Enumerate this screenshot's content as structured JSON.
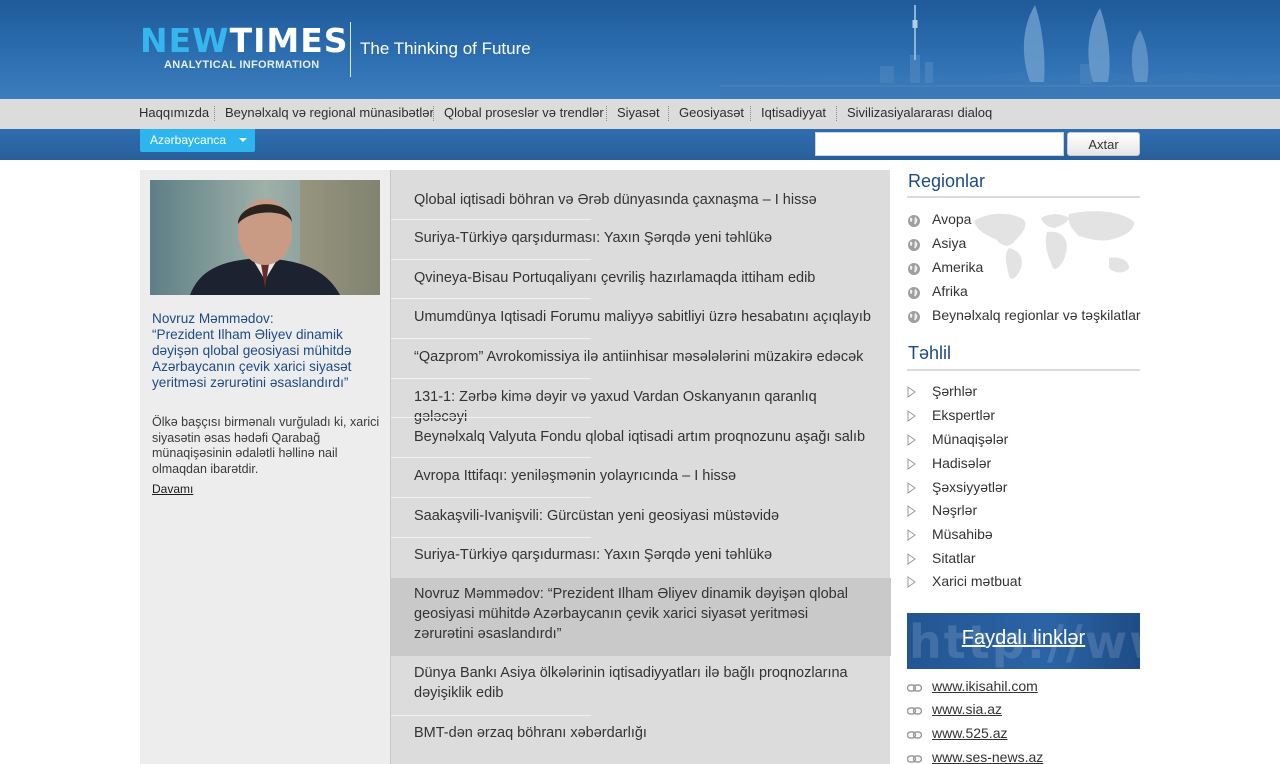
{
  "header": {
    "logo_new": "NEW",
    "logo_times": "TIMES",
    "logo_sub": "ANALYTICAL INFORMATION",
    "tagline": "The Thinking of Future"
  },
  "nav": [
    {
      "label": "Haqqımızda"
    },
    {
      "label": "Beynəlxalq və regional münasibətlər"
    },
    {
      "label": "Qlobal proseslər və trendlər"
    },
    {
      "label": "Siyasət"
    },
    {
      "label": "Geosiyasət"
    },
    {
      "label": "Iqtisadiyyat"
    },
    {
      "label": "Sivilizasiyalararası dialoq"
    }
  ],
  "language": {
    "selected": "Azərbaycanca"
  },
  "search": {
    "value": "",
    "button": "Axtar"
  },
  "featured": {
    "title": "Novruz Məmmədov:\n“Prezident Ilham Əliyev dinamik dəyişən qlobal geosiyasi mühitdə Azərbaycanın çevik xarici siyasət yeritməsi zərurətini əsaslandırdı”",
    "text": "Ölkə başçısı birmənalı vurğuladı ki, xarici siyasətin əsas hədəfi Qarabağ münaqişəsinin ədalətli həllinə nail olmaqdan ibarətdir.",
    "more": "Davamı"
  },
  "news": [
    {
      "title": "Qlobal iqtisadi böhran və Ərəb dünyasında çaxnaşma – I hissə",
      "active": false
    },
    {
      "title": "Suriya-Türkiyə qarşıdurması: Yaxın Şərqdə yeni təhlükə",
      "active": false
    },
    {
      "title": "Qvineya-Bisau Portuqaliyanı çevriliş hazırlamaqda ittiham edib",
      "active": false
    },
    {
      "title": "Umumdünya Iqtisadi Forumu maliyyə sabitliyi üzrə hesabatını açıqlayıb",
      "active": false
    },
    {
      "title": "“Qazprom” Avrokomissiya ilə antiinhisar məsələlərini müzakirə edəcək",
      "active": false
    },
    {
      "title": "131-1: Zərbə kimə dəyir və yaxud Vardan Oskanyanın qaranlıq gələcəyi",
      "active": false
    },
    {
      "title": "Beynəlxalq Valyuta Fondu qlobal iqtisadi artım proqnozunu aşağı salıb",
      "active": false
    },
    {
      "title": "Avropa Ittifaqı: yeniləşmənin yolayrıcında – I hissə",
      "active": false
    },
    {
      "title": "Saakaşvili-Ivanişvili: Gürcüstan yeni geosiyasi müstəvidə",
      "active": false
    },
    {
      "title": "Suriya-Türkiyə qarşıdurması: Yaxın Şərqdə yeni təhlükə",
      "active": false
    },
    {
      "title": "Novruz Məmmədov: “Prezident Ilham Əliyev dinamik dəyişən qlobal geosiyasi mühitdə Azərbaycanın çevik xarici siyasət yeritməsi zərurətini əsaslandırdı”",
      "active": true
    },
    {
      "title": "Dünya Bankı Asiya ölkələrinin iqtisadiyyatları ilə bağlı proqnozlarına dəyişiklik edib",
      "active": false
    },
    {
      "title": "BMT-dən ərzaq böhranı xəbərdarlığı",
      "active": false
    }
  ],
  "regions": {
    "title": "Regionlar",
    "items": [
      "Avopa",
      "Asiya",
      "Amerika",
      "Afrika",
      "Beynəlxalq regionlar və təşkilatlar"
    ]
  },
  "analysis": {
    "title": "Təhlil",
    "items": [
      "Şərhlər",
      "Ekspertlər",
      "Münaqişələr",
      "Hadisələr",
      "Şəxsiyyətlər",
      "Nəşrlər",
      "Müsahibə",
      "Sitatlar",
      "Xarici mətbuat"
    ]
  },
  "useful_links": {
    "title": "Faydalı linklər",
    "watermark": "http://www",
    "items": [
      "www.ikisahil.com",
      "www.sia.az",
      "www.525.az",
      "www.ses-news.az"
    ]
  },
  "colors": {
    "header_blue": "#2c6eb0",
    "logo_cyan": "#35b6ee",
    "link_blue": "#1d4b86",
    "nav_gray": "#dcdcdc",
    "active_item": "#c9c9c9"
  }
}
